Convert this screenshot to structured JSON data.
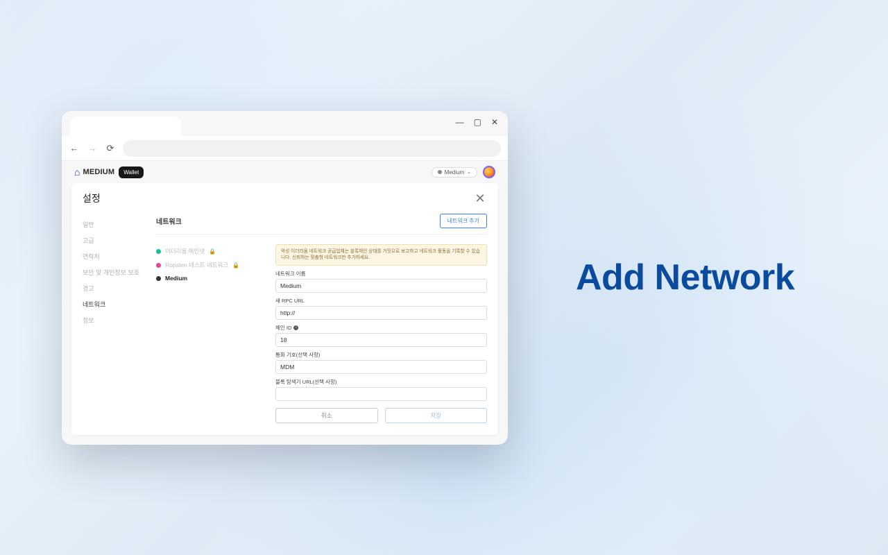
{
  "hero": "Add Network",
  "brand": {
    "name": "MEDIUM",
    "pill": "Wallet"
  },
  "netSelector": "Medium",
  "card": {
    "title": "설정"
  },
  "sidebar": [
    {
      "label": "일반",
      "active": false
    },
    {
      "label": "고급",
      "active": false
    },
    {
      "label": "연락처",
      "active": false
    },
    {
      "label": "보안 및 개인정보 보호",
      "active": false
    },
    {
      "label": "경고",
      "active": false
    },
    {
      "label": "네트워크",
      "active": true
    },
    {
      "label": "정보",
      "active": false
    }
  ],
  "section": {
    "title": "네트워크",
    "addBtn": "네트워크 추가"
  },
  "networks": [
    {
      "label": "이더리움 메인넷",
      "color": "teal",
      "locked": true,
      "active": false
    },
    {
      "label": "Ropsten 테스트 네트워크",
      "color": "pink",
      "locked": true,
      "active": false
    },
    {
      "label": "Medium",
      "color": "dark",
      "locked": false,
      "active": true
    }
  ],
  "form": {
    "warning": "악성 이더리움 네트워크 공급업체는 블록체인 상태를 거짓으로 보고하고 네트워크 활동을 기록할 수 있습니다. 신뢰하는 맞춤형 네트워크만 추가하세요.",
    "networkName": {
      "label": "네트워크 이름",
      "value": "Medium"
    },
    "rpcUrl": {
      "label": "새 RPC URL",
      "value": "http://"
    },
    "chainId": {
      "label": "체인 ID",
      "value": "18"
    },
    "symbol": {
      "label": "통화 기호(선택 사항)",
      "value": "MDM"
    },
    "explorer": {
      "label": "블록 탐색기 URL(선택 사항)",
      "value": ""
    },
    "cancel": "취소",
    "save": "저장"
  }
}
